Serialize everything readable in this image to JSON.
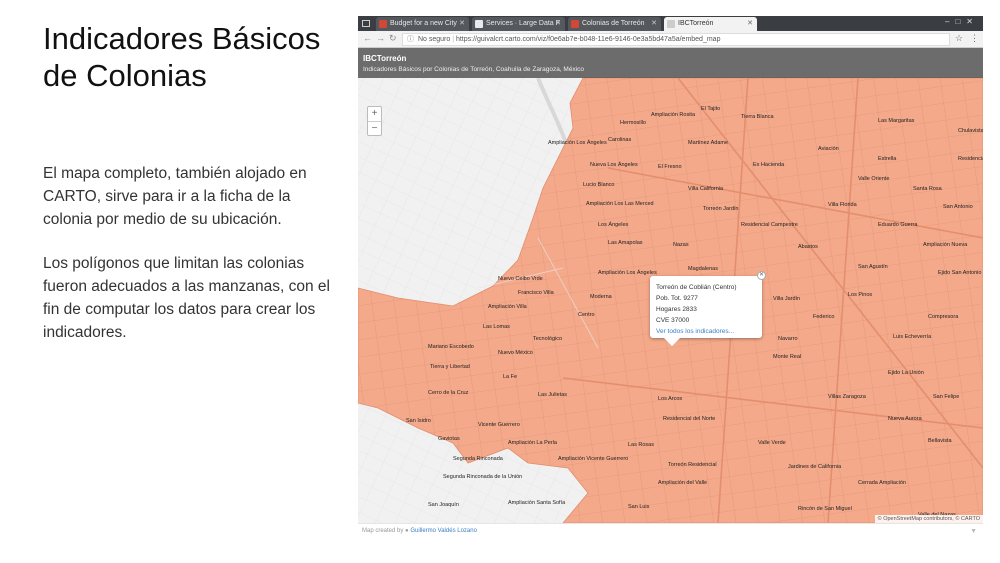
{
  "slide": {
    "title": "Indicadores Básicos de Colonias",
    "paragraph1": "El mapa completo, también alojado en CARTO, sirve para ir a la ficha de la colonia por medio de su ubicación.",
    "paragraph2": "Los polígonos que limitan las colonias fueron adecuados a las manzanas, con el fin de computar los datos para crear los indicadores."
  },
  "browser": {
    "tabs": [
      {
        "label": "Budget for a new City",
        "favicon_color": "#d14836",
        "active": false
      },
      {
        "label": "Services · Large Data F",
        "favicon_color": "#e8eaed",
        "active": false
      },
      {
        "label": "Colonias de Torreón",
        "favicon_color": "#d14836",
        "active": false
      },
      {
        "label": "IBCTorreón",
        "favicon_color": "#cccccc",
        "active": true
      }
    ],
    "security_label": "No seguro",
    "url": "https://guivalcrt.carto.com/viz/f0e6ab7e-b048-11e6-9146-0e3a5bd47a5a/embed_map"
  },
  "map": {
    "header_title": "IBCTorreón",
    "header_subtitle": "Indicadores Básicos por Colonias de Torreón, Coahuila de Zaragoza, México",
    "polygon_color": "#f4a98a",
    "popup": {
      "name": "Torreón de Coblián (Centro)",
      "population": "Pob. Tot. 9277",
      "households": "Hogares 2833",
      "cve": "CVE 37000",
      "link": "Ver todos los indicadores..."
    },
    "attribution": "© OpenStreetMap contributors, © CARTO",
    "credit_prefix": "Map created by",
    "credit_author": "Guillermo Valdés Lozano"
  }
}
